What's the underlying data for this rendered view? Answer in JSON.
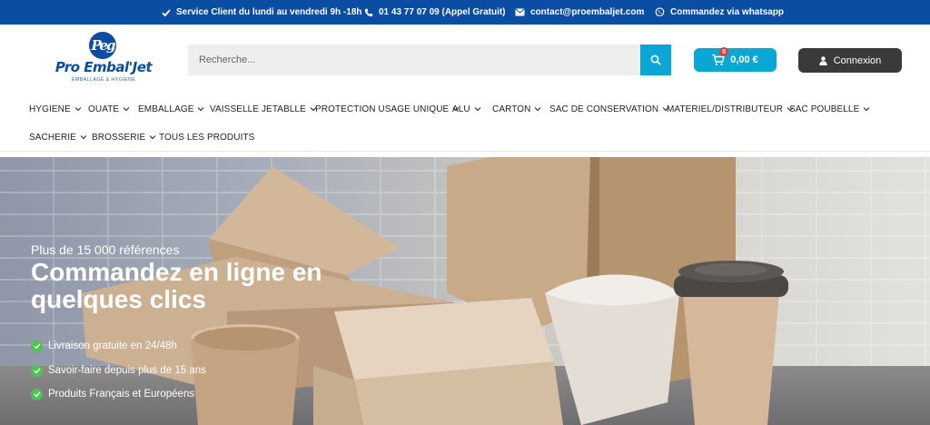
{
  "topbar": {
    "service": "Service Client du lundi au vendredi 9h -18h",
    "phone": "01 43 77 07 09 (Appel Gratuit)",
    "email": "contact@proembaljet.com",
    "whatsapp": "Commandez via whatsapp"
  },
  "logo": {
    "mark": "Peg",
    "brand": "Pro Embal'Jet",
    "tagline": "EMBALLAGE & HYGIENE"
  },
  "search": {
    "placeholder": "Recherche..."
  },
  "cart": {
    "count": "0",
    "amount": "0,00 €"
  },
  "login": {
    "label": "Connexion"
  },
  "nav": {
    "items": [
      {
        "label": "HYGIENE",
        "dropdown": true
      },
      {
        "label": "OUATE",
        "dropdown": true
      },
      {
        "label": "EMBALLAGE",
        "dropdown": true
      },
      {
        "label": "VAISSELLE JETABLLE",
        "dropdown": true
      },
      {
        "label": "PROTECTION USAGE UNIQUE",
        "dropdown": true
      },
      {
        "label": "ALU",
        "dropdown": true
      },
      {
        "label": "CARTON",
        "dropdown": true
      },
      {
        "label": "SAC DE CONSERVATION",
        "dropdown": true
      },
      {
        "label": "MATERIEL/DISTRIBUTEUR",
        "dropdown": true
      },
      {
        "label": "SAC POUBELLE",
        "dropdown": true
      },
      {
        "label": "SACHERIE",
        "dropdown": true
      },
      {
        "label": "BROSSERIE",
        "dropdown": true
      },
      {
        "label": "TOUS LES PRODUITS",
        "dropdown": false
      }
    ]
  },
  "hero": {
    "eyebrow": "Plus de 15 000 références",
    "headline": "Commandez en ligne en quelques clics",
    "bullets": [
      "Livraison gratuite en 24/48h",
      "Savoir-faire depuis plus de 15 ans",
      "Produits Français et Européens"
    ]
  },
  "colors": {
    "topbar": "#0a4da2",
    "accent": "#0aa6d6",
    "login_bg": "#3a3a3a",
    "check": "#4fc254",
    "badge": "#e53935"
  }
}
